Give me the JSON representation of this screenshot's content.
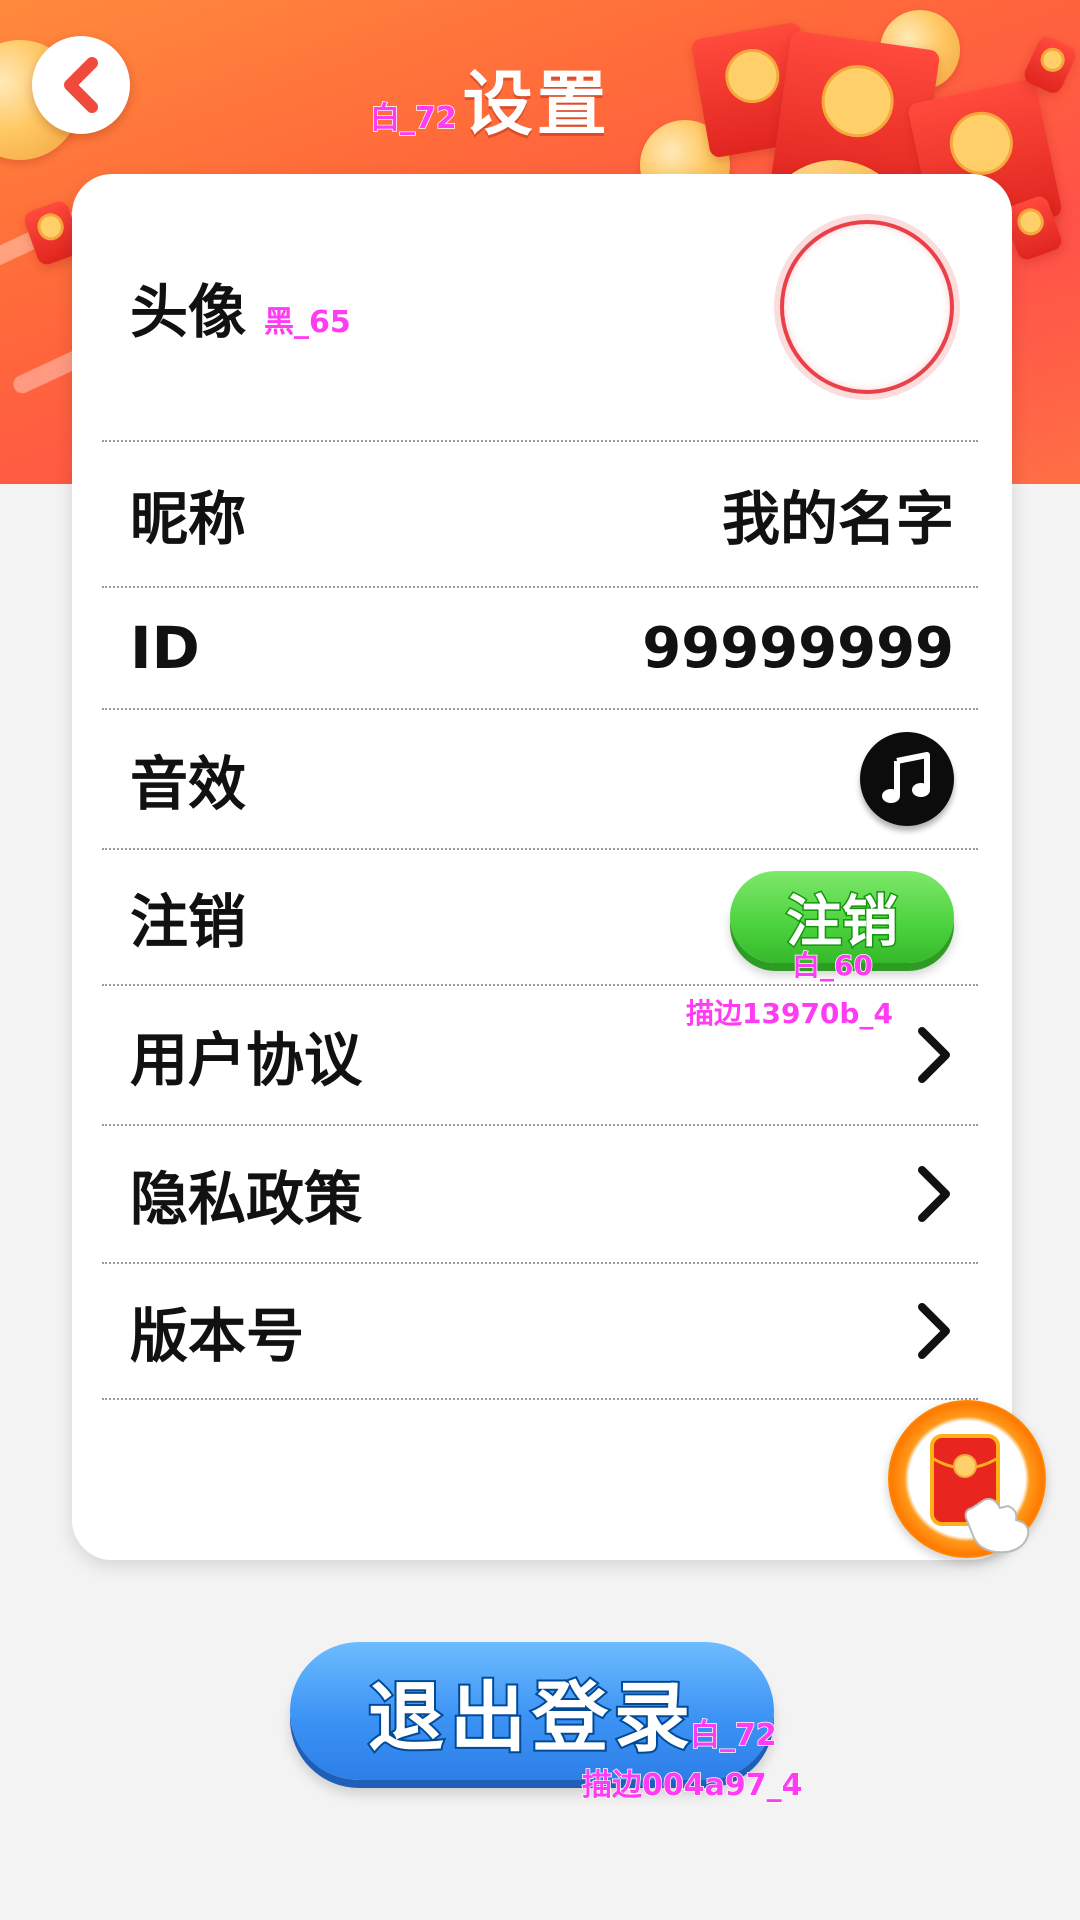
{
  "header": {
    "title": "设置",
    "title_annotation": "白_72",
    "back_icon": "chevron-left-icon"
  },
  "rows": {
    "avatar": {
      "label": "头像",
      "annotation": "黑_65"
    },
    "nickname": {
      "label": "昵称",
      "value": "我的名字"
    },
    "id": {
      "label": "ID",
      "value": "99999999"
    },
    "sound": {
      "label": "音效",
      "icon": "music-note-icon"
    },
    "cancel_account": {
      "label": "注销",
      "button_label": "注销",
      "annotation_color": "白_60",
      "annotation_stroke": "描边13970b_4"
    },
    "user_agreement": {
      "label": "用户协议"
    },
    "privacy_policy": {
      "label": "隐私政策"
    },
    "version": {
      "label": "版本号"
    }
  },
  "floating": {
    "icon": "red-envelope-icon"
  },
  "logout": {
    "label": "退出登录",
    "annotation_color": "白_72",
    "annotation_stroke": "描边004a97_4"
  },
  "colors": {
    "header_orange": "#ff6a3a",
    "cancel_green": "#4bd23e",
    "cancel_stroke": "#13970b",
    "logout_blue": "#3c93f4",
    "logout_stroke": "#004a97",
    "annotation_magenta": "#ff3bf4"
  }
}
